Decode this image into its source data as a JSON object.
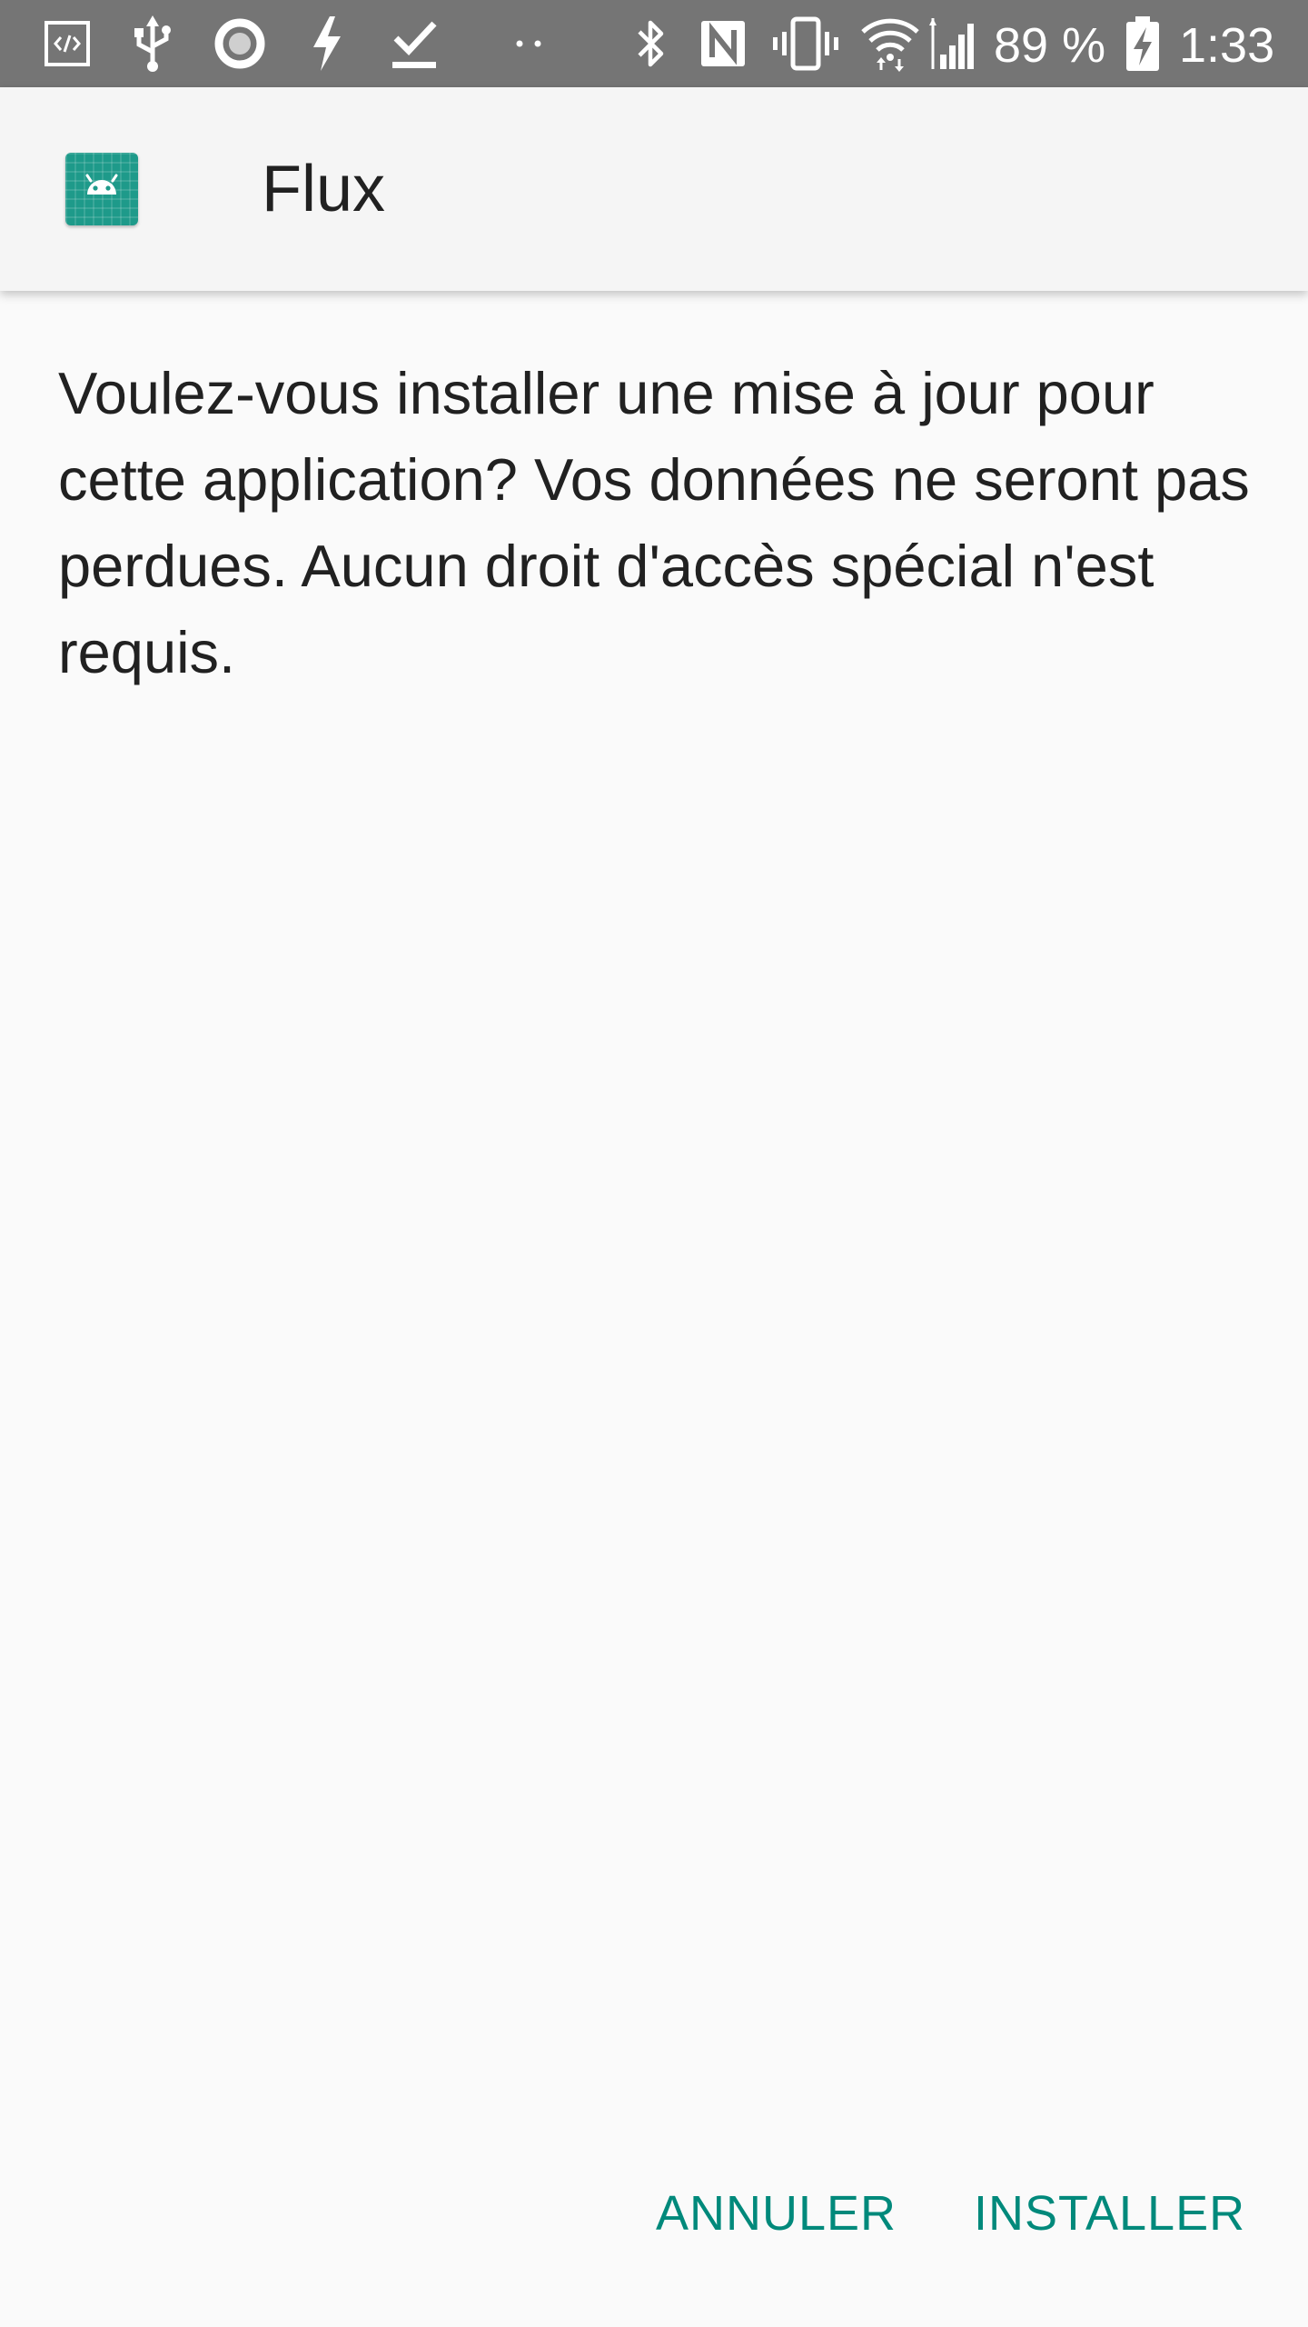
{
  "status_bar": {
    "icons": [
      "developer-mode-icon",
      "usb-icon",
      "circle-icon",
      "flash-icon",
      "download-done-icon",
      "more-dots-icon",
      "bluetooth-icon",
      "nfc-icon",
      "vibrate-icon",
      "wifi-icon",
      "cell-signal-icon",
      "battery-charging-icon"
    ],
    "battery_percent": "89 %",
    "time": "1:33"
  },
  "app_bar": {
    "icon": "android-app-icon",
    "title": "Flux"
  },
  "content": {
    "message": "Voulez-vous installer une mise à jour pour cette application? Vos données ne seront pas perdues. Aucun droit d'accès spécial n'est requis."
  },
  "actions": {
    "cancel_label": "ANNULER",
    "install_label": "INSTALLER"
  },
  "colors": {
    "status_bar": "#757575",
    "app_bar": "#f5f5f5",
    "background": "#fafafa",
    "accent": "#00897b",
    "app_icon": "#1e9a8a",
    "text_primary": "#212121"
  }
}
